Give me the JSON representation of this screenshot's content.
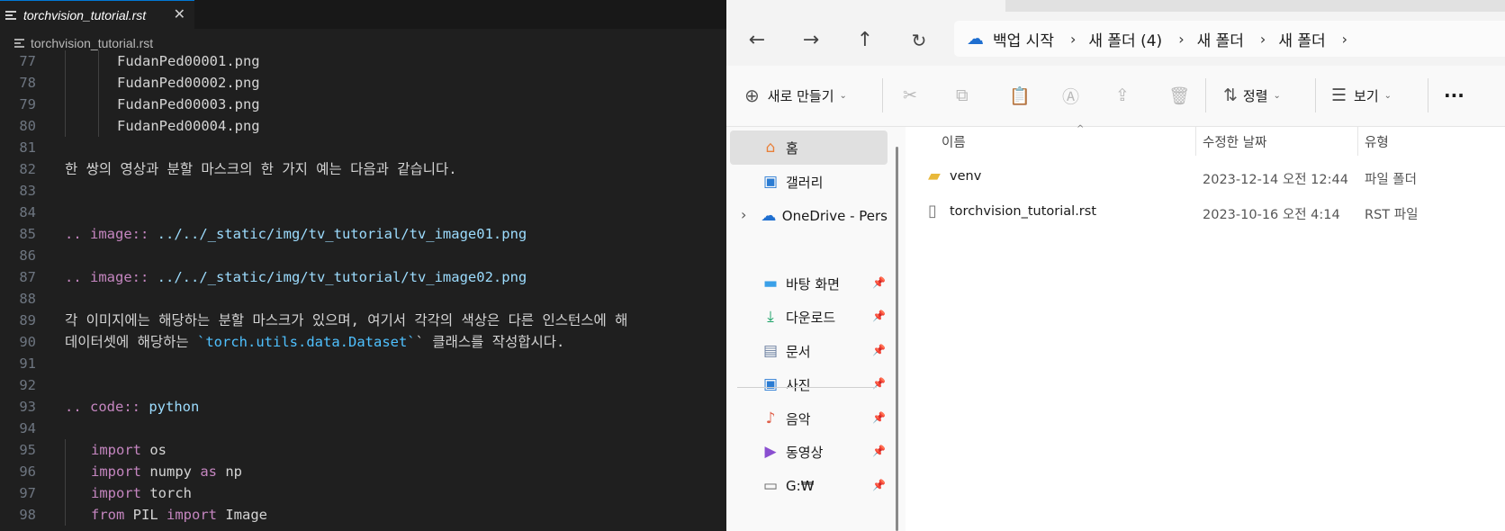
{
  "editor": {
    "tab_label": "torchvision_tutorial.rst",
    "tab_close": "✕",
    "breadcrumb": "torchvision_tutorial.rst",
    "lines": [
      {
        "num": "77",
        "guides": 2,
        "segs": [
          {
            "c": "n",
            "t": "FudanPed00001.png"
          }
        ],
        "indent": 4
      },
      {
        "num": "78",
        "guides": 2,
        "segs": [
          {
            "c": "n",
            "t": "FudanPed00002.png"
          }
        ],
        "indent": 4
      },
      {
        "num": "79",
        "guides": 2,
        "segs": [
          {
            "c": "n",
            "t": "FudanPed00003.png"
          }
        ],
        "indent": 4
      },
      {
        "num": "80",
        "guides": 2,
        "segs": [
          {
            "c": "n",
            "t": "FudanPed00004.png"
          }
        ],
        "indent": 4
      },
      {
        "num": "81",
        "guides": 0,
        "segs": [],
        "indent": 0
      },
      {
        "num": "82",
        "guides": 0,
        "segs": [
          {
            "c": "n",
            "t": "한 쌍의 영상과 분할 마스크의 한 가지 예는 다음과 같습니다."
          }
        ],
        "indent": 0
      },
      {
        "num": "83",
        "guides": 0,
        "segs": [],
        "indent": 0
      },
      {
        "num": "84",
        "guides": 0,
        "segs": [],
        "indent": 0
      },
      {
        "num": "85",
        "guides": 0,
        "segs": [
          {
            "c": "k",
            "t": ".. image:: "
          },
          {
            "c": "u",
            "t": "../../_static/img/tv_tutorial/tv_image01.png"
          }
        ],
        "indent": 0
      },
      {
        "num": "86",
        "guides": 0,
        "segs": [],
        "indent": 0
      },
      {
        "num": "87",
        "guides": 0,
        "segs": [
          {
            "c": "k",
            "t": ".. image:: "
          },
          {
            "c": "u",
            "t": "../../_static/img/tv_tutorial/tv_image02.png"
          }
        ],
        "indent": 0
      },
      {
        "num": "88",
        "guides": 0,
        "segs": [],
        "indent": 0
      },
      {
        "num": "89",
        "guides": 0,
        "segs": [
          {
            "c": "n",
            "t": "각 이미지에는 해당하는 분할 마스크가 있으며, 여기서 각각의 색상은 다른 인스턴스에 해"
          }
        ],
        "indent": 0
      },
      {
        "num": "90",
        "guides": 0,
        "segs": [
          {
            "c": "n",
            "t": "데이터셋에 해당하는 "
          },
          {
            "c": "p",
            "t": "`torch.utils.data.Dataset`"
          },
          {
            "c": "n",
            "t": "` 클래스를 작성합시다."
          }
        ],
        "indent": 0
      },
      {
        "num": "91",
        "guides": 0,
        "segs": [],
        "indent": 0
      },
      {
        "num": "92",
        "guides": 0,
        "segs": [],
        "indent": 0
      },
      {
        "num": "93",
        "guides": 0,
        "segs": [
          {
            "c": "k",
            "t": ".. code:: "
          },
          {
            "c": "u",
            "t": "python"
          }
        ],
        "indent": 0
      },
      {
        "num": "94",
        "guides": 0,
        "segs": [],
        "indent": 0
      },
      {
        "num": "95",
        "guides": 1,
        "segs": [
          {
            "c": "k",
            "t": "import "
          },
          {
            "c": "n",
            "t": "os"
          }
        ],
        "indent": 2
      },
      {
        "num": "96",
        "guides": 1,
        "segs": [
          {
            "c": "k",
            "t": "import "
          },
          {
            "c": "n",
            "t": "numpy "
          },
          {
            "c": "k",
            "t": "as "
          },
          {
            "c": "n",
            "t": "np"
          }
        ],
        "indent": 2
      },
      {
        "num": "97",
        "guides": 1,
        "segs": [
          {
            "c": "k",
            "t": "import "
          },
          {
            "c": "n",
            "t": "torch"
          }
        ],
        "indent": 2
      },
      {
        "num": "98",
        "guides": 1,
        "segs": [
          {
            "c": "k",
            "t": "from "
          },
          {
            "c": "n",
            "t": "PIL "
          },
          {
            "c": "k",
            "t": "import "
          },
          {
            "c": "n",
            "t": "Image"
          }
        ],
        "indent": 2
      }
    ]
  },
  "explorer": {
    "address": {
      "root": "백업 시작",
      "crumbs": [
        "새 폴더 (4)",
        "새 폴더",
        "새 폴더"
      ]
    },
    "toolbar": {
      "new_label": "새로 만들기",
      "sort_label": "정렬",
      "view_label": "보기",
      "more_label": "···"
    },
    "nav": [
      {
        "name": "home",
        "label": "홈",
        "icon": "⌂",
        "color": "#e8803a",
        "selected": true,
        "pin": false
      },
      {
        "name": "gallery",
        "label": "갤러리",
        "icon": "▣",
        "color": "#2b7cd3",
        "selected": false,
        "pin": false
      },
      {
        "name": "onedrive",
        "label": "OneDrive - Pers",
        "icon": "☁",
        "color": "#1f6fd0",
        "selected": false,
        "pin": false
      },
      {
        "name": "desktop",
        "label": "바탕 화면",
        "icon": "▬",
        "color": "#3aa0e8",
        "selected": false,
        "pin": true
      },
      {
        "name": "downloads",
        "label": "다운로드",
        "icon": "⤓",
        "color": "#1aa267",
        "selected": false,
        "pin": true
      },
      {
        "name": "documents",
        "label": "문서",
        "icon": "▤",
        "color": "#6b7fa0",
        "selected": false,
        "pin": true
      },
      {
        "name": "pictures",
        "label": "사진",
        "icon": "▣",
        "color": "#2b7cd3",
        "selected": false,
        "pin": true
      },
      {
        "name": "music",
        "label": "음악",
        "icon": "♪",
        "color": "#e0604a",
        "selected": false,
        "pin": true
      },
      {
        "name": "videos",
        "label": "동영상",
        "icon": "▶",
        "color": "#8a4fd0",
        "selected": false,
        "pin": true
      },
      {
        "name": "drive-g",
        "label": "G:₩",
        "icon": "▭",
        "color": "#666666",
        "selected": false,
        "pin": true
      }
    ],
    "columns": {
      "name": "이름",
      "modified": "수정한 날짜",
      "type": "유형"
    },
    "files": [
      {
        "name": "venv",
        "modified": "2023-12-14 오전 12:44",
        "type": "파일 폴더",
        "kind": "folder"
      },
      {
        "name": "torchvision_tutorial.rst",
        "modified": "2023-10-16 오전 4:14",
        "type": "RST 파일",
        "kind": "file"
      }
    ]
  }
}
